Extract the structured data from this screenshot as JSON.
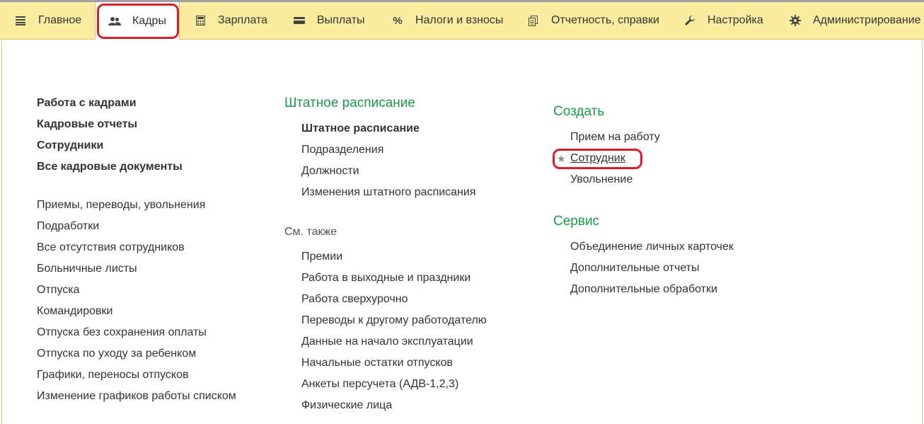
{
  "nav": {
    "items": [
      {
        "label": "Главное",
        "icon": "menu-lines-icon"
      },
      {
        "label": "Кадры",
        "icon": "people-icon"
      },
      {
        "label": "Зарплата",
        "icon": "calculator-icon"
      },
      {
        "label": "Выплаты",
        "icon": "wallet-icon"
      },
      {
        "label": "Налоги и взносы",
        "icon": "percent-icon"
      },
      {
        "label": "Отчетность, справки",
        "icon": "documents-icon"
      },
      {
        "label": "Настройка",
        "icon": "wrench-icon"
      },
      {
        "label": "Администрирование",
        "icon": "gear-icon"
      }
    ],
    "active": "Кадры"
  },
  "col1": {
    "main_links": [
      "Работа с кадрами",
      "Кадровые отчеты",
      "Сотрудники",
      "Все кадровые документы"
    ],
    "links": [
      "Приемы, переводы, увольнения",
      "Подработки",
      "Все отсутствия сотрудников",
      "Больничные листы",
      "Отпуска",
      "Командировки",
      "Отпуска без сохранения оплаты",
      "Отпуска по уходу за ребенком",
      "Графики, переносы отпусков",
      "Изменение графиков работы списком"
    ]
  },
  "col2": {
    "section_title": "Штатное расписание",
    "section_links": [
      "Штатное расписание",
      "Подразделения",
      "Должности",
      "Изменения штатного расписания"
    ],
    "see_also_title": "См. также",
    "see_also_links": [
      "Премии",
      "Работа в выходные и праздники",
      "Работа сверхурочно",
      "Переводы к другому работодателю",
      "Данные на начало эксплуатации",
      "Начальные остатки отпусков",
      "Анкеты персучета (АДВ-1,2,3)",
      "Физические лица"
    ]
  },
  "col3": {
    "create_title": "Создать",
    "create_links": [
      "Прием на работу",
      "Сотрудник",
      "Увольнение"
    ],
    "service_title": "Сервис",
    "service_links": [
      "Объединение личных карточек",
      "Дополнительные отчеты",
      "Дополнительные обработки"
    ]
  },
  "colors": {
    "nav_bg": "#fbeda0",
    "header_green": "#1a9a4b",
    "highlight_red": "#d81e28"
  }
}
